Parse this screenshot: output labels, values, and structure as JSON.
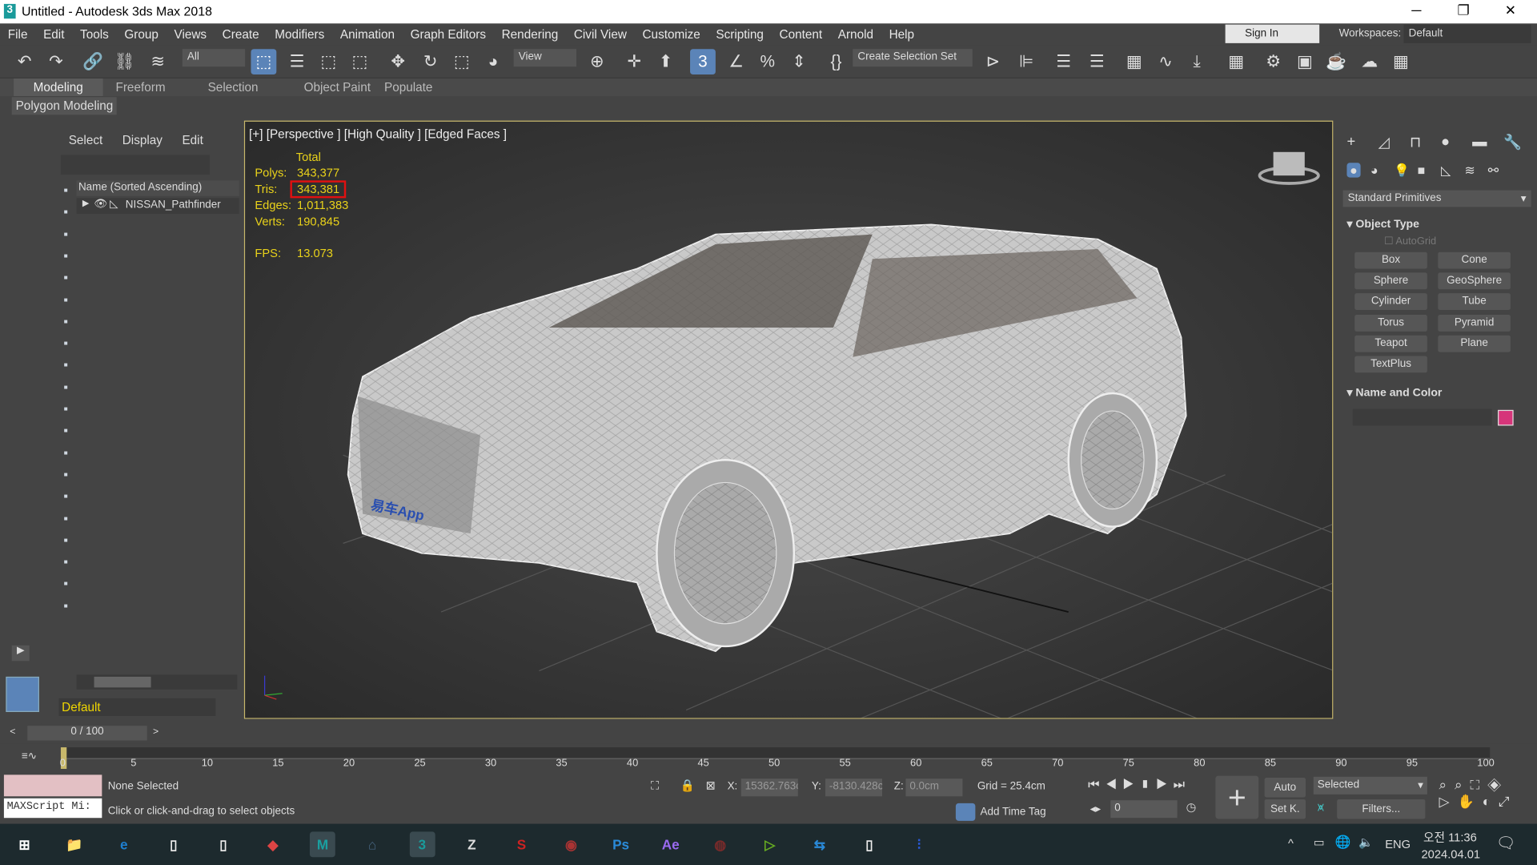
{
  "window": {
    "title": "Untitled - Autodesk 3ds Max 2018",
    "minimize": "─",
    "restore": "❐",
    "close": "✕"
  },
  "menu": [
    "File",
    "Edit",
    "Tools",
    "Group",
    "Views",
    "Create",
    "Modifiers",
    "Animation",
    "Graph Editors",
    "Rendering",
    "Civil View",
    "Customize",
    "Scripting",
    "Content",
    "Arnold",
    "Help"
  ],
  "account": {
    "sign_in": "Sign In",
    "workspaces_label": "Workspaces:",
    "workspace": "Default"
  },
  "toolbar": {
    "filter": "All",
    "ref_coord": "View",
    "selection_set": "Create Selection Set",
    "icons": [
      "undo-icon",
      "redo-icon",
      "link-icon",
      "unlink-icon",
      "bind-space-warp-icon",
      "select-object-icon",
      "select-by-name-icon",
      "rect-selection-icon",
      "window-crossing-icon",
      "move-icon",
      "rotate-icon",
      "scale-icon",
      "place-icon",
      "pivot-icon",
      "keyboard-shortcut-icon",
      "selection-lock-icon",
      "snap-3d-icon",
      "angle-snap-icon",
      "percent-snap-icon",
      "spinner-snap-icon",
      "edit-named-sets-icon",
      "mirror-icon",
      "align-icon",
      "scene-explorer-icon",
      "layer-explorer-icon",
      "ribbon-toggle-icon",
      "curve-editor-icon",
      "schematic-view-icon",
      "material-editor-icon",
      "render-setup-icon",
      "rendered-frame-icon",
      "render-icon",
      "render-cloud-icon",
      "a360-icon"
    ]
  },
  "ribbon": {
    "tabs": [
      "Modeling",
      "Freeform",
      "Selection",
      "Object Paint",
      "Populate"
    ],
    "active": "Modeling",
    "panel": "Polygon Modeling"
  },
  "scene_explorer": {
    "menus": [
      "Select",
      "Display",
      "Edit"
    ],
    "column": "Name (Sorted Ascending)",
    "items": [
      {
        "name": "NISSAN_Pathfinder"
      }
    ],
    "layer": "Default"
  },
  "viewport": {
    "label": "[+] [Perspective ] [High Quality ] [Edged Faces ]",
    "stats_header": "Total",
    "stats": [
      {
        "label": "Polys:",
        "value": "343,377"
      },
      {
        "label": "Tris:",
        "value": "343,381",
        "highlighted": true
      },
      {
        "label": "Edges:",
        "value": "1,011,383"
      },
      {
        "label": "Verts:",
        "value": "190,845"
      }
    ],
    "fps_label": "FPS:",
    "fps": "13.073",
    "watermark": "易车App",
    "highlight_color": "#e01010",
    "stats_color": "#e9d21a"
  },
  "command_panel": {
    "category": "Standard Primitives",
    "rollout_object_type": "Object Type",
    "autogrid": "AutoGrid",
    "buttons": [
      "Box",
      "Cone",
      "Sphere",
      "GeoSphere",
      "Cylinder",
      "Tube",
      "Torus",
      "Pyramid",
      "Teapot",
      "Plane",
      "TextPlus"
    ],
    "rollout_name_color": "Name and Color",
    "object_color": "#d6357a"
  },
  "timeline": {
    "frame": "0 / 100",
    "ticks": [
      "0",
      "5",
      "10",
      "15",
      "20",
      "25",
      "30",
      "35",
      "40",
      "45",
      "50",
      "55",
      "60",
      "65",
      "70",
      "75",
      "80",
      "85",
      "90",
      "95",
      "100"
    ]
  },
  "status": {
    "maxscript": "MAXScript Mi:",
    "selection": "None Selected",
    "prompt": "Click or click-and-drag to select objects",
    "x_label": "X:",
    "x": "15362.763c",
    "y_label": "Y:",
    "y": "-8130.428cı",
    "z_label": "Z:",
    "z": "0.0cm",
    "grid": "Grid = 25.4cm",
    "add_time_tag": "Add Time Tag",
    "frame_value": "0",
    "auto": "Auto",
    "set_key": "Set K.",
    "key_filter": "Selected",
    "filters": "Filters..."
  },
  "taskbar": {
    "apps": [
      "start",
      "file-explorer",
      "edge",
      "document",
      "document",
      "autodesk-app",
      "maya",
      "3dsmax-launcher",
      "3ds-max",
      "zbrush",
      "substance",
      "app",
      "photoshop",
      "after-effects",
      "davinci",
      "camtasia",
      "app2",
      "document",
      "tool"
    ],
    "lang": "ENG",
    "time": "오전 11:36",
    "date": "2024.04.01"
  }
}
